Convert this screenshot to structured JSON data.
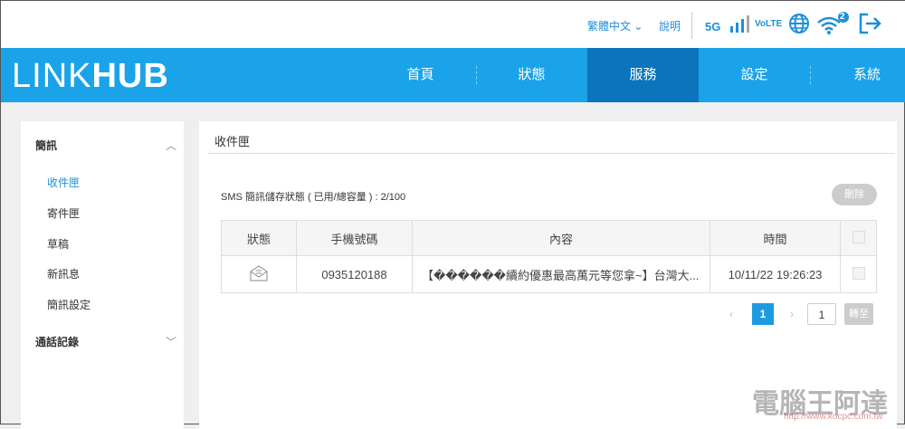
{
  "topbar": {
    "language": "繁體中文",
    "help": "說明",
    "status_5g": "5G",
    "volte": "VoLTE",
    "wifi_clients": "2"
  },
  "header": {
    "logo_a": "LINK",
    "logo_b": "HUB",
    "nav": [
      "首頁",
      "狀態",
      "服務",
      "設定",
      "系統"
    ],
    "active_nav": "服務"
  },
  "sidebar": {
    "group1": "簡訊",
    "items": [
      "收件匣",
      "寄件匣",
      "草稿",
      "新訊息",
      "簡訊設定"
    ],
    "active": "收件匣",
    "group2": "通話記錄"
  },
  "main": {
    "title": "收件匣",
    "storage": "SMS 簡訊儲存狀態 ( 已用/總容量 ) : 2/100",
    "delete": "刪除",
    "columns": [
      "狀態",
      "手機號碼",
      "內容",
      "時間"
    ],
    "rows": [
      {
        "phone": "0935120188",
        "content": "【������續約優惠最高萬元等您拿~】台灣大...",
        "time": "10/11/22 19:26:23"
      }
    ],
    "pager": {
      "prev": "‹",
      "current": "1",
      "next": "›",
      "goto_value": "1",
      "goto": "轉至"
    }
  },
  "watermark": {
    "text": "電腦王阿達",
    "url": "http://www.kocpc.com.tw"
  }
}
